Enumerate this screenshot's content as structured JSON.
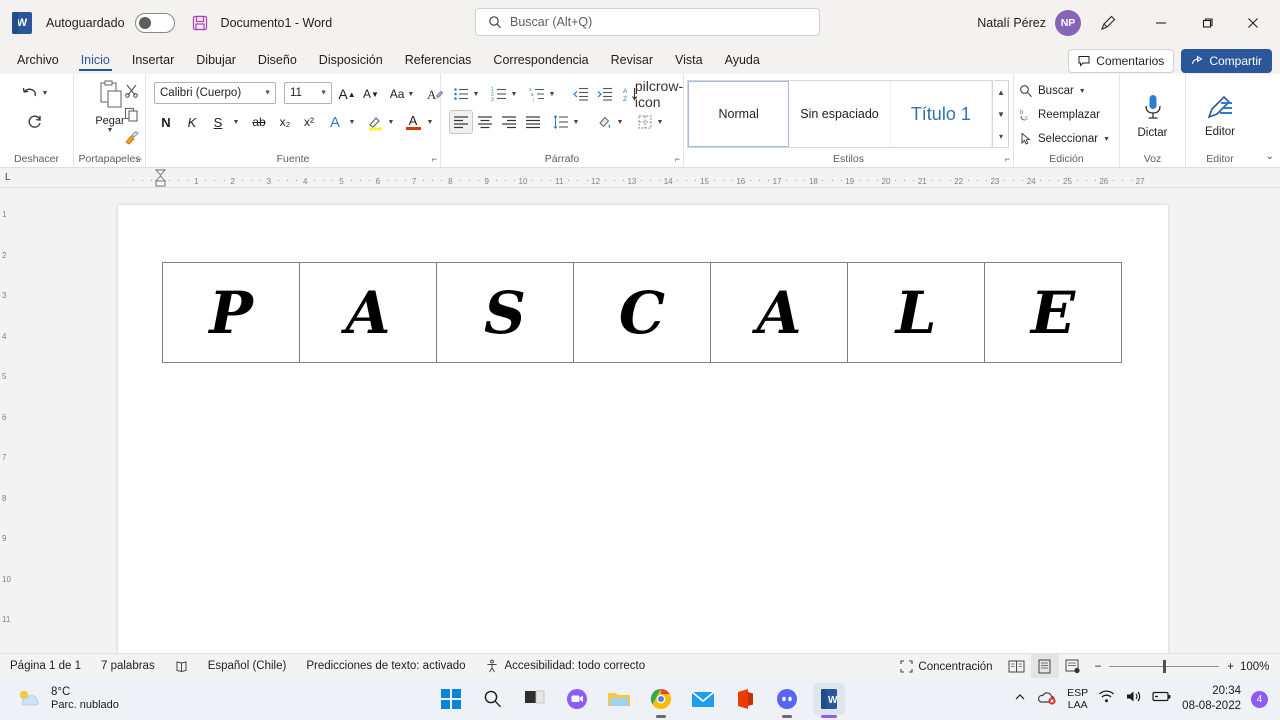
{
  "titlebar": {
    "app_icon": "word-logo",
    "autosave_label": "Autoguardado",
    "autosave_state": "off",
    "save_icon": "save-icon",
    "document_title": "Documento1  -  Word",
    "search_placeholder": "Buscar (Alt+Q)",
    "user_name": "Natalí Pérez",
    "avatar_initials": "NP",
    "pen_icon": "pen-icon",
    "minimize": "—",
    "maximize": "▢",
    "close": "✕",
    "accent_color": "#2b579a",
    "avatar_color": "#8764b8"
  },
  "tabs": [
    {
      "label": "Archivo",
      "active": false
    },
    {
      "label": "Inicio",
      "active": true
    },
    {
      "label": "Insertar",
      "active": false
    },
    {
      "label": "Dibujar",
      "active": false
    },
    {
      "label": "Diseño",
      "active": false
    },
    {
      "label": "Disposición",
      "active": false
    },
    {
      "label": "Referencias",
      "active": false
    },
    {
      "label": "Correspondencia",
      "active": false
    },
    {
      "label": "Revisar",
      "active": false
    },
    {
      "label": "Vista",
      "active": false
    },
    {
      "label": "Ayuda",
      "active": false
    }
  ],
  "tabs_right": {
    "comments_label": "Comentarios",
    "share_label": "Compartir"
  },
  "ribbon": {
    "groups": {
      "undo": {
        "label": "Deshacer",
        "undo_icon": "undo-arrow-icon",
        "redo_icon": "redo-arrow-icon"
      },
      "clipboard": {
        "label": "Portapapeles",
        "paste_label": "Pegar",
        "paste_icon": "clipboard-paste-icon",
        "cut_icon": "scissors-icon",
        "copy_icon": "copy-icon",
        "format_painter_icon": "format-painter-icon",
        "dialog_launcher": "⌐"
      },
      "font": {
        "label": "Fuente",
        "font_name": "Calibri (Cuerpo)",
        "font_size": "11",
        "grow_font": "A",
        "shrink_font": "A",
        "change_case": "Aa",
        "clear_formatting_icon": "clear-formatting-icon",
        "bold": "N",
        "italic": "K",
        "underline": "S",
        "strikethrough": "ab",
        "subscript": "x₂",
        "superscript": "x²",
        "text_effects": "A",
        "highlight": "A",
        "font_color": "A",
        "dialog_launcher": "⌐"
      },
      "paragraph": {
        "label": "Párrafo",
        "bullets_icon": "bullet-list-icon",
        "numbering_icon": "numbered-list-icon",
        "multilevel_icon": "multilevel-list-icon",
        "decrease_indent_icon": "decrease-indent-icon",
        "increase_indent_icon": "increase-indent-icon",
        "sort_icon": "sort-az-icon",
        "show_marks_icon": "pilcrow-icon",
        "align_left_icon": "align-left-icon",
        "align_center_icon": "align-center-icon",
        "align_right_icon": "align-right-icon",
        "justify_icon": "justify-icon",
        "line_spacing_icon": "line-spacing-icon",
        "shading_icon": "shading-icon",
        "borders_icon": "borders-icon",
        "dialog_launcher": "⌐"
      },
      "styles": {
        "label": "Estilos",
        "items": [
          {
            "name": "Normal",
            "selected": true
          },
          {
            "name": "Sin espaciado",
            "selected": false
          },
          {
            "name": "Título 1",
            "selected": false
          }
        ],
        "scroll_up": "▲",
        "scroll_down": "▼",
        "scroll_more": "▾",
        "dialog_launcher": "⌐"
      },
      "editing": {
        "label": "Edición",
        "find": "Buscar",
        "replace": "Reemplazar",
        "select": "Seleccionar",
        "find_icon": "search-icon",
        "replace_icon": "replace-icon",
        "select_icon": "cursor-select-icon"
      },
      "voice": {
        "label": "Voz",
        "dictate": "Dictar",
        "dictate_icon": "microphone-icon"
      },
      "editor": {
        "label": "Editor",
        "editor_btn": "Editor",
        "editor_icon": "editor-pen-icon"
      }
    },
    "collapse_icon": "chevron-down-icon"
  },
  "ruler": {
    "tab_stop_indicator": "L",
    "marks": [
      "1",
      "2",
      "3",
      "4",
      "5",
      "6",
      "7",
      "8",
      "9",
      "10",
      "11",
      "12",
      "13",
      "14",
      "15",
      "16",
      "17",
      "18",
      "19",
      "20",
      "21",
      "22",
      "23",
      "24",
      "25",
      "26",
      "27"
    ],
    "vertical_marks": [
      "1",
      "2",
      "3",
      "4",
      "5",
      "6",
      "7",
      "8",
      "9",
      "10",
      "11"
    ]
  },
  "document": {
    "table": {
      "rows": [
        [
          "P",
          "A",
          "S",
          "C",
          "A",
          "L",
          "E"
        ]
      ],
      "columns": 7
    }
  },
  "statusbar": {
    "page": "Página 1 de 1",
    "words": "7 palabras",
    "proofing_icon": "proofing-icon",
    "language": "Español (Chile)",
    "text_predictions": "Predicciones de texto: activado",
    "accessibility_icon": "accessibility-icon",
    "accessibility": "Accesibilidad: todo correcto",
    "focus_icon": "focus-icon",
    "focus": "Concentración",
    "view_read_icon": "read-mode-icon",
    "view_print_icon": "print-layout-icon",
    "view_web_icon": "web-layout-icon",
    "zoom_out": "−",
    "zoom_in": "+",
    "zoom_level": "100%"
  },
  "taskbar": {
    "weather": {
      "temperature": "8°C",
      "condition": "Parc. nublado",
      "icon": "partly-cloudy-icon"
    },
    "apps": [
      {
        "name": "start-icon",
        "label": "Inicio"
      },
      {
        "name": "search-icon",
        "label": "Buscar"
      },
      {
        "name": "task-view-icon",
        "label": "Vista de tareas"
      },
      {
        "name": "chat-icon",
        "label": "Chat"
      },
      {
        "name": "file-explorer-icon",
        "label": "Explorador de archivos"
      },
      {
        "name": "chrome-icon",
        "label": "Google Chrome"
      },
      {
        "name": "mail-icon",
        "label": "Correo"
      },
      {
        "name": "office-icon",
        "label": "Office"
      },
      {
        "name": "discord-icon",
        "label": "Discord"
      },
      {
        "name": "word-icon",
        "label": "Word"
      }
    ],
    "tray": {
      "overflow_icon": "chevron-up-icon",
      "onedrive_icon": "onedrive-error-icon",
      "keyboard_line1": "ESP",
      "keyboard_line2": "LAA",
      "wifi_icon": "wifi-icon",
      "volume_icon": "volume-icon",
      "battery_icon": "battery-icon",
      "time": "20:34",
      "date": "08-08-2022",
      "notification_count": "4"
    }
  }
}
